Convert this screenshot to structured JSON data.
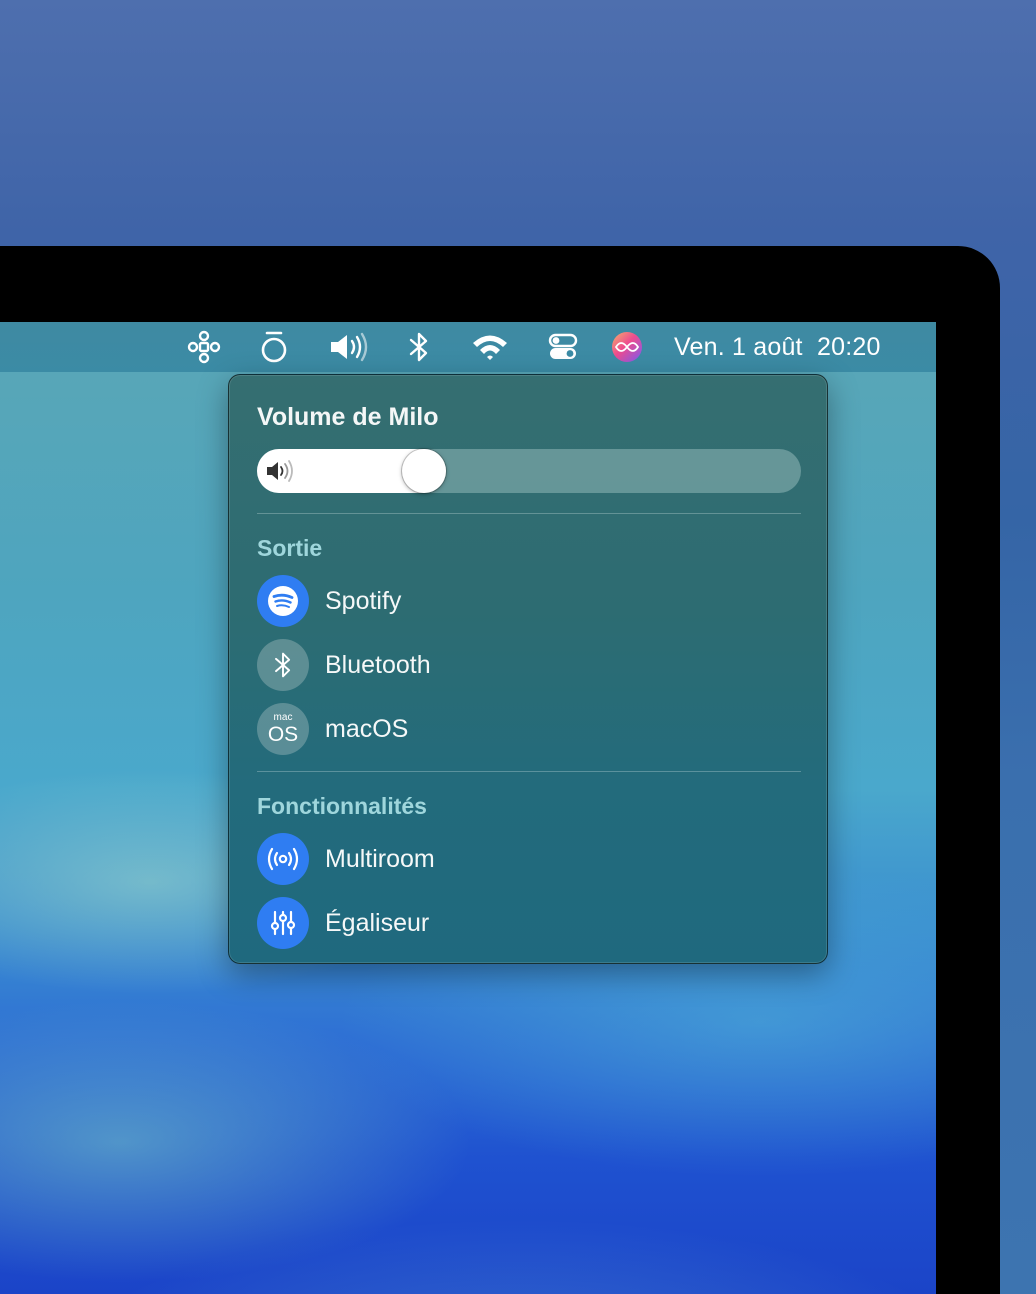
{
  "menubar": {
    "icons": [
      "shortcuts-icon",
      "focus-icon",
      "volume-icon",
      "bluetooth-icon",
      "wifi-icon",
      "control-center-icon",
      "siri-icon"
    ],
    "clock_date": "Ven. 1 août",
    "clock_time": "20:20"
  },
  "popup": {
    "title": "Volume de Milo",
    "volume_fraction": 0.29,
    "output_section": {
      "label": "Sortie",
      "items": [
        {
          "label": "Spotify",
          "icon": "spotify-icon",
          "active": true
        },
        {
          "label": "Bluetooth",
          "icon": "bluetooth-icon",
          "active": false
        },
        {
          "label": "macOS",
          "icon": "macos-icon",
          "active": false,
          "icon_small": "mac",
          "icon_big": "OS"
        }
      ]
    },
    "features_section": {
      "label": "Fonctionnalités",
      "items": [
        {
          "label": "Multiroom",
          "icon": "multiroom-icon"
        },
        {
          "label": "Égaliseur",
          "icon": "equalizer-icon"
        }
      ]
    }
  },
  "colors": {
    "accent_blue": "#2f7df2",
    "section_label": "#9fd6dc"
  }
}
